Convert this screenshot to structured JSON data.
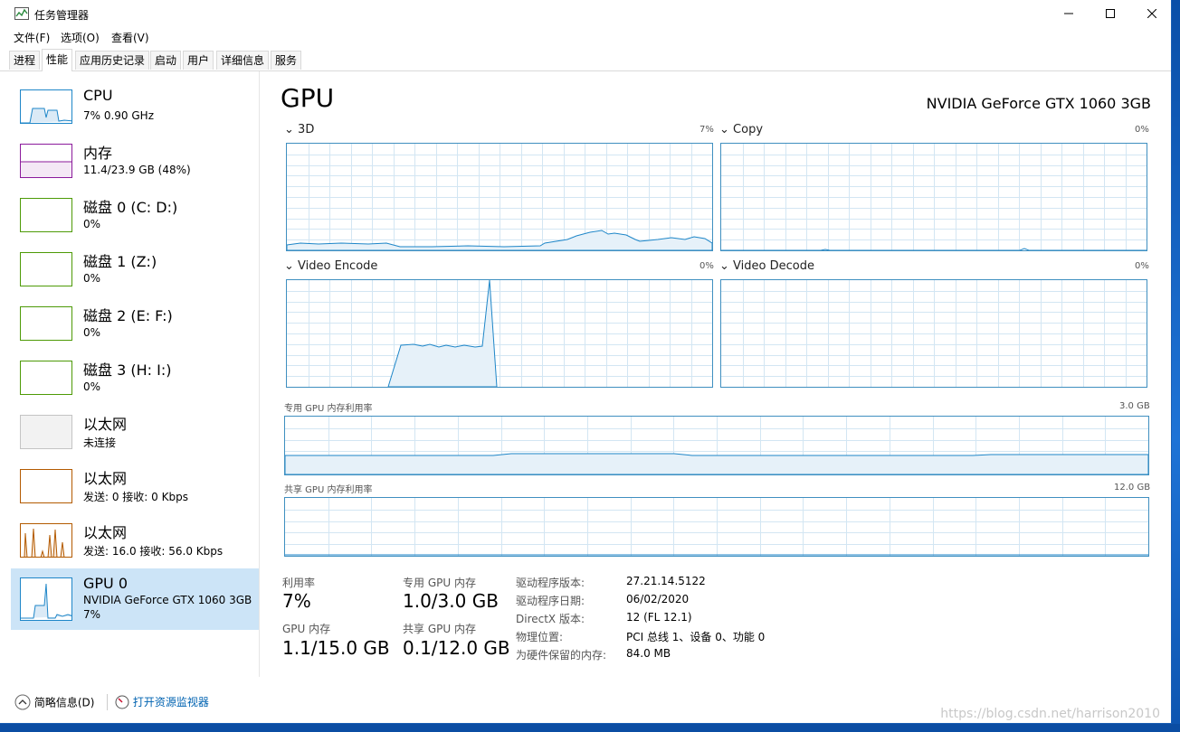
{
  "window": {
    "title": "任务管理器"
  },
  "menu": [
    "文件(F)",
    "选项(O)",
    "查看(V)"
  ],
  "tabs": [
    "进程",
    "性能",
    "应用历史记录",
    "启动",
    "用户",
    "详细信息",
    "服务"
  ],
  "sidebar": [
    {
      "name": "CPU",
      "sub": "7% 0.90 GHz",
      "color": "#1e86c8"
    },
    {
      "name": "内存",
      "sub": "11.4/23.9 GB (48%)",
      "color": "#8b1a9b"
    },
    {
      "name": "磁盘 0 (C: D:)",
      "sub": "0%",
      "color": "#4d9a06"
    },
    {
      "name": "磁盘 1 (Z:)",
      "sub": "0%",
      "color": "#4d9a06"
    },
    {
      "name": "磁盘 2 (E: F:)",
      "sub": "0%",
      "color": "#4d9a06"
    },
    {
      "name": "磁盘 3 (H: I:)",
      "sub": "0%",
      "color": "#4d9a06"
    },
    {
      "name": "以太网",
      "sub": "未连接",
      "color": "#b9b9b9"
    },
    {
      "name": "以太网",
      "sub": "发送: 0 接收: 0 Kbps",
      "color": "#b35a00"
    },
    {
      "name": "以太网",
      "sub": "发送: 16.0 接收: 56.0 Kbps",
      "color": "#b35a00"
    },
    {
      "name": "GPU 0",
      "sub": "NVIDIA GeForce GTX 1060 3GB",
      "sub2": "7%",
      "color": "#1e86c8"
    }
  ],
  "main": {
    "title": "GPU",
    "model": "NVIDIA GeForce GTX 1060 3GB",
    "graphs": [
      {
        "label": "3D",
        "pct": "7%"
      },
      {
        "label": "Copy",
        "pct": "0%"
      },
      {
        "label": "Video Encode",
        "pct": "0%"
      },
      {
        "label": "Video Decode",
        "pct": "0%"
      }
    ],
    "dedicated_label": "专用 GPU 内存利用率",
    "dedicated_max": "3.0 GB",
    "shared_label": "共享 GPU 内存利用率",
    "shared_max": "12.0 GB"
  },
  "stats": {
    "util_label": "利用率",
    "util_value": "7%",
    "ded_label": "专用 GPU 内存",
    "ded_value": "1.0/3.0 GB",
    "gpumem_label": "GPU 内存",
    "gpumem_value": "1.1/15.0 GB",
    "shared_label": "共享 GPU 内存",
    "shared_value": "0.1/12.0 GB"
  },
  "info": [
    {
      "key": "驱动程序版本:",
      "val": "27.21.14.5122"
    },
    {
      "key": "驱动程序日期:",
      "val": "06/02/2020"
    },
    {
      "key": "DirectX 版本:",
      "val": "12 (FL 12.1)"
    },
    {
      "key": "物理位置:",
      "val": "PCI 总线 1、设备 0、功能 0"
    },
    {
      "key": "为硬件保留的内存:",
      "val": "84.0 MB"
    }
  ],
  "footer": {
    "brief": "简略信息(D)",
    "monitor": "打开资源监视器"
  },
  "watermark": "https://blog.csdn.net/harrison2010",
  "colors": {
    "accent": "#1e86c8",
    "selected": "#cce4f7",
    "grid": "#d3e6f3"
  }
}
